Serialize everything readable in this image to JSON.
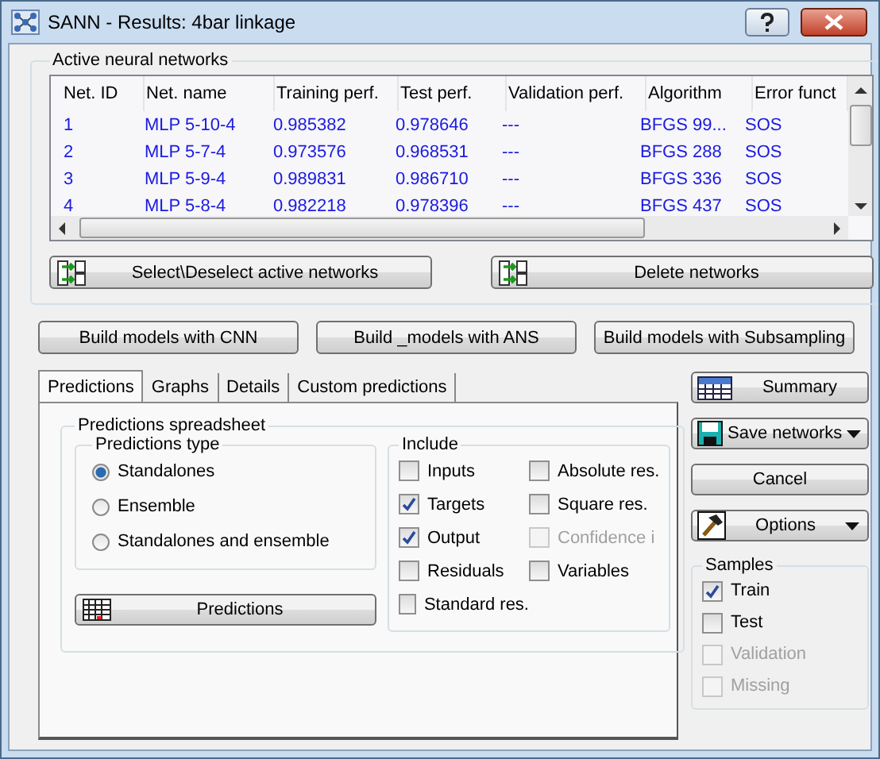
{
  "window": {
    "title": "SANN - Results: 4bar linkage"
  },
  "networks_group": {
    "title": "Active neural networks",
    "columns": [
      "Net. ID",
      "Net. name",
      "Training perf.",
      "Test perf.",
      "Validation perf.",
      "Algorithm",
      "Error funct"
    ],
    "rows": [
      [
        "1",
        "MLP 5-10-4",
        "0.985382",
        "0.978646",
        "---",
        "BFGS 99...",
        "SOS"
      ],
      [
        "2",
        "MLP 5-7-4",
        "0.973576",
        "0.968531",
        "---",
        "BFGS 288",
        "SOS"
      ],
      [
        "3",
        "MLP 5-9-4",
        "0.989831",
        "0.986710",
        "---",
        "BFGS 336",
        "SOS"
      ],
      [
        "4",
        "MLP 5-8-4",
        "0.982218",
        "0.978396",
        "---",
        "BFGS 437",
        "SOS"
      ]
    ],
    "buttons": [
      "Select\\Deselect active networks",
      "Delete networks"
    ]
  },
  "build_buttons": [
    "Build models with CNN",
    "Build _models with ANS",
    "Build models with Subsampling"
  ],
  "tabs": [
    {
      "label": "Predictions",
      "selected": true
    },
    {
      "label": "Graphs",
      "selected": false
    },
    {
      "label": "Details",
      "selected": false
    },
    {
      "label": "Custom predictions",
      "selected": false
    }
  ],
  "spreadsheet": {
    "title": "Predictions spreadsheet",
    "type_group": {
      "title": "Predictions type",
      "options": [
        {
          "label": "Standalones",
          "selected": true
        },
        {
          "label": "Ensemble",
          "selected": false
        },
        {
          "label": "Standalones and ensemble",
          "selected": false
        }
      ]
    },
    "include": {
      "title": "Include",
      "items": [
        {
          "label": "Inputs",
          "checked": false,
          "disabled": false
        },
        {
          "label": "Targets",
          "checked": true,
          "disabled": false
        },
        {
          "label": "Output",
          "checked": true,
          "disabled": false
        },
        {
          "label": "Residuals",
          "checked": false,
          "disabled": false
        },
        {
          "label": "Standard res.",
          "checked": false,
          "disabled": false
        },
        {
          "label": "Absolute res.",
          "checked": false,
          "disabled": false
        },
        {
          "label": "Square res.",
          "checked": false,
          "disabled": false
        },
        {
          "label": "Confidence i",
          "checked": false,
          "disabled": true
        },
        {
          "label": "Variables",
          "checked": false,
          "disabled": false
        }
      ]
    },
    "predictions_button": "Predictions"
  },
  "side_buttons": [
    {
      "label": "Summary",
      "kind": "grid"
    },
    {
      "label": "Save networks",
      "kind": "save"
    },
    {
      "label": "Cancel",
      "kind": "plain"
    },
    {
      "label": "Options",
      "kind": "options"
    }
  ],
  "samples": {
    "title": "Samples",
    "items": [
      {
        "label": "Train",
        "checked": true,
        "disabled": false
      },
      {
        "label": "Test",
        "checked": false,
        "disabled": false
      },
      {
        "label": "Validation",
        "checked": false,
        "disabled": true
      },
      {
        "label": "Missing",
        "checked": false,
        "disabled": true
      }
    ]
  }
}
